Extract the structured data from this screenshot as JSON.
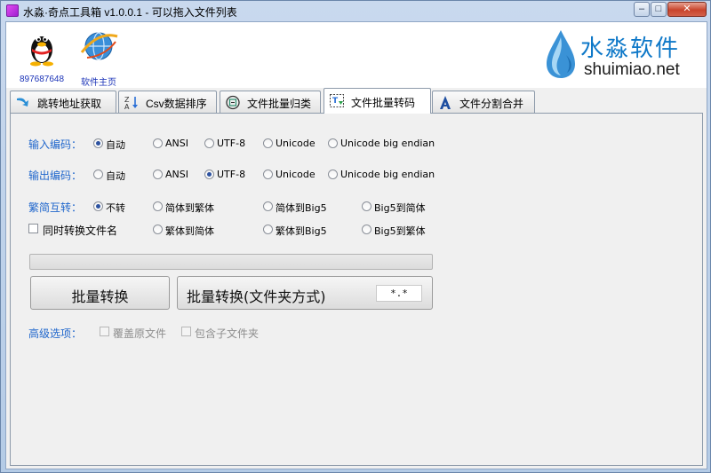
{
  "window": {
    "title": "水淼·奇点工具箱 v1.0.0.1 - 可以拖入文件列表",
    "min_glyph": "–",
    "max_glyph": "□",
    "close_glyph": "✕"
  },
  "header": {
    "links": [
      {
        "label": "897687648",
        "icon": "qq-penguin-icon"
      },
      {
        "label": "软件主页",
        "icon": "ie-globe-icon"
      }
    ],
    "brand_cn": "水淼软件",
    "brand_en": "shuimiao.net"
  },
  "tabs": [
    {
      "label": "跳转地址获取",
      "icon": "arrow-icon",
      "active": false
    },
    {
      "label": "Csv数据排序",
      "icon": "sort-az-icon",
      "active": false
    },
    {
      "label": "文件批量归类",
      "icon": "classify-icon",
      "active": false
    },
    {
      "label": "文件批量转码",
      "icon": "transcode-icon",
      "active": true
    },
    {
      "label": "文件分割合并",
      "icon": "split-merge-icon",
      "active": false
    }
  ],
  "input_encoding": {
    "label": "输入编码：",
    "options": [
      "自动",
      "ANSI",
      "UTF-8",
      "Unicode",
      "Unicode big endian"
    ],
    "selected": "自动"
  },
  "output_encoding": {
    "label": "输出编码：",
    "options": [
      "自动",
      "ANSI",
      "UTF-8",
      "Unicode",
      "Unicode big endian"
    ],
    "selected": "UTF-8"
  },
  "conversion": {
    "label": "繁简互转：",
    "row1": [
      "不转",
      "简体到繁体",
      "简体到Big5",
      "Big5到简体"
    ],
    "row2": [
      "繁体到简体",
      "繁体到Big5",
      "Big5到繁体"
    ],
    "selected": "不转",
    "rename_checkbox": "同时转换文件名"
  },
  "progress": 0.0,
  "buttons": {
    "batch": "批量转换",
    "batch_folder": "批量转换(文件夹方式)",
    "extension": "*.*"
  },
  "advanced": {
    "label": "高级选项：",
    "overwrite": "覆盖原文件",
    "include_sub": "包含子文件夹"
  },
  "colors": {
    "accent_label": "#1f66cc",
    "brand_blue": "#0e78c8",
    "link_blue": "#1c34b8"
  }
}
